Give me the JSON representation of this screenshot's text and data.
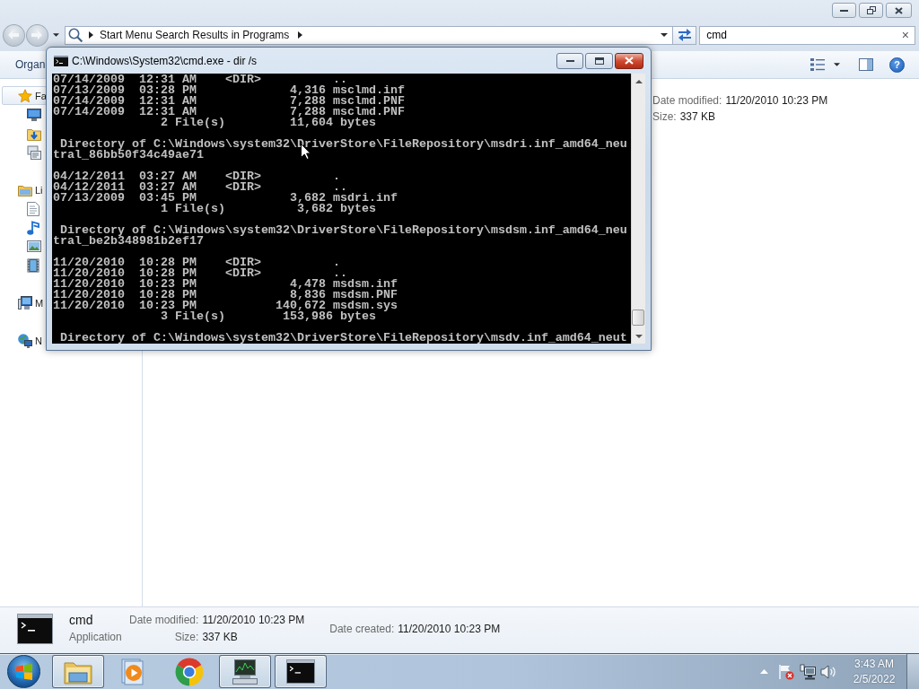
{
  "explorer": {
    "address_bar": {
      "breadcrumbs": [
        "Start Menu Search Results in Programs"
      ]
    },
    "search": {
      "value": "cmd",
      "clear": "×"
    },
    "toolbar": {
      "organize": "Organ",
      "help": "?"
    },
    "navigation": [
      {
        "label": "Fa",
        "kind": "favorites",
        "selected": true,
        "children": [
          {
            "kind": "desktop",
            "selected": false
          },
          {
            "kind": "downloads",
            "selected": false
          },
          {
            "kind": "recent",
            "selected": false
          }
        ]
      },
      {
        "label": "Li",
        "kind": "libraries",
        "selected": false,
        "children": [
          {
            "kind": "documents",
            "selected": false
          },
          {
            "kind": "music",
            "selected": false
          },
          {
            "kind": "pictures",
            "selected": false
          },
          {
            "kind": "videos",
            "selected": false
          }
        ]
      },
      {
        "label": "M",
        "kind": "computer",
        "selected": false
      },
      {
        "label": "N",
        "kind": "network",
        "selected": false
      }
    ],
    "results": [
      {
        "details": [
          {
            "label": "Date modified:",
            "value": "11/20/2010 10:23 PM"
          },
          {
            "label": "Size:",
            "value": "337 KB"
          }
        ]
      }
    ],
    "details_pane": {
      "name": "cmd",
      "type": "Application",
      "fields": [
        {
          "label": "Date modified:",
          "value": "11/20/2010 10:23 PM"
        },
        {
          "label": "Size:",
          "value": "337 KB"
        },
        {
          "label": "Date created:",
          "value": "11/20/2010 10:23 PM"
        }
      ]
    }
  },
  "console_window": {
    "title": "C:\\Windows\\System32\\cmd.exe - dir /s",
    "output": [
      [
        "07/14/2009  12:31 AM    <DIR>          ..",
        "07/13/2009  03:28 PM             4,316 msclmd.inf",
        "07/14/2009  12:31 AM             7,288 msclmd.PNF",
        "07/14/2009  12:31 AM             7,288 msclmd.PNF",
        "               2 File(s)         11,604 bytes"
      ],
      [
        " Directory of C:\\Windows\\system32\\DriverStore\\FileRepository\\msdri.inf_amd64_neu",
        "tral_86bb50f34c49ae71"
      ],
      [
        "04/12/2011  03:27 AM    <DIR>          .",
        "04/12/2011  03:27 AM    <DIR>          ..",
        "07/13/2009  03:45 PM             3,682 msdri.inf",
        "               1 File(s)          3,682 bytes"
      ],
      [
        " Directory of C:\\Windows\\system32\\DriverStore\\FileRepository\\msdsm.inf_amd64_neu",
        "tral_be2b348981b2ef17"
      ],
      [
        "11/20/2010  10:28 PM    <DIR>          .",
        "11/20/2010  10:28 PM    <DIR>          ..",
        "11/20/2010  10:23 PM             4,478 msdsm.inf",
        "11/20/2010  10:28 PM             8,836 msdsm.PNF",
        "11/20/2010  10:23 PM           140,672 msdsm.sys",
        "               3 File(s)        153,986 bytes"
      ],
      [
        " Directory of C:\\Windows\\system32\\DriverStore\\FileRepository\\msdv.inf_amd64_neut"
      ]
    ]
  },
  "taskbar": {
    "apps": [
      {
        "kind": "explorer",
        "running": true
      },
      {
        "kind": "media",
        "running": false
      },
      {
        "kind": "browser",
        "running": false
      },
      {
        "kind": "monitor",
        "running": true
      },
      {
        "kind": "terminal",
        "running": true
      }
    ],
    "clock": {
      "time": "3:43 AM",
      "date": "2/5/2022"
    }
  }
}
